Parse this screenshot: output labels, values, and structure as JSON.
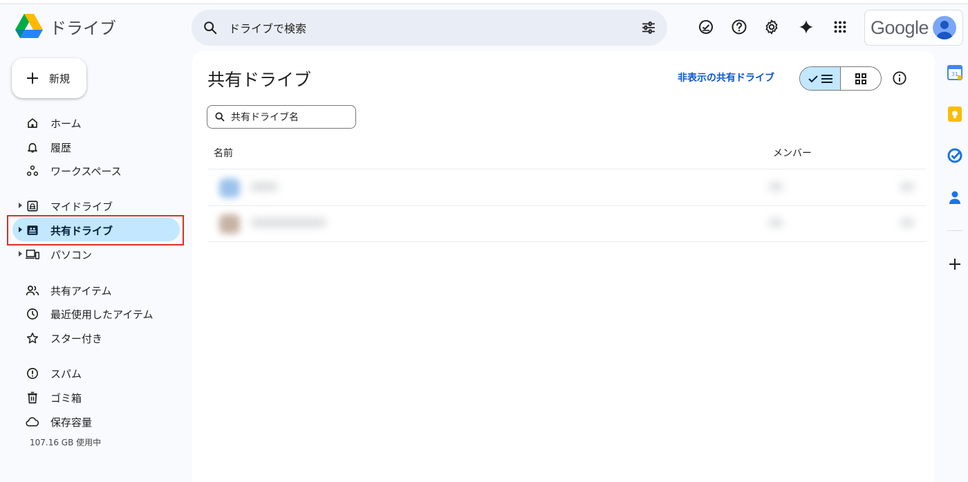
{
  "app": {
    "name": "ドライブ"
  },
  "search": {
    "placeholder": "ドライブで検索"
  },
  "header": {
    "account_wordmark": "Google"
  },
  "sidebar": {
    "new_label": "新規",
    "items": [
      {
        "label": "ホーム",
        "icon": "home-icon"
      },
      {
        "label": "履歴",
        "icon": "bell-icon"
      },
      {
        "label": "ワークスペース",
        "icon": "workspaces-icon"
      },
      {
        "label": "マイドライブ",
        "icon": "my-drive-icon"
      },
      {
        "label": "共有ドライブ",
        "icon": "shared-drive-icon",
        "active": true
      },
      {
        "label": "パソコン",
        "icon": "computers-icon"
      },
      {
        "label": "共有アイテム",
        "icon": "people-icon"
      },
      {
        "label": "最近使用したアイテム",
        "icon": "clock-icon"
      },
      {
        "label": "スター付き",
        "icon": "star-icon"
      },
      {
        "label": "スパム",
        "icon": "spam-icon"
      },
      {
        "label": "ゴミ箱",
        "icon": "trash-icon"
      },
      {
        "label": "保存容量",
        "icon": "cloud-icon"
      }
    ],
    "storage_used": "107.16 GB 使用中"
  },
  "main": {
    "title": "共有ドライブ",
    "hidden_link": "非表示の共有ドライブ",
    "filter_placeholder": "共有ドライブ名",
    "columns": {
      "name": "名前",
      "members": "メンバー"
    }
  },
  "colors": {
    "accent": "#0b57d0",
    "active_bg": "#c2e7ff",
    "highlight_border": "#d93025",
    "search_bg": "#e9eef6"
  }
}
